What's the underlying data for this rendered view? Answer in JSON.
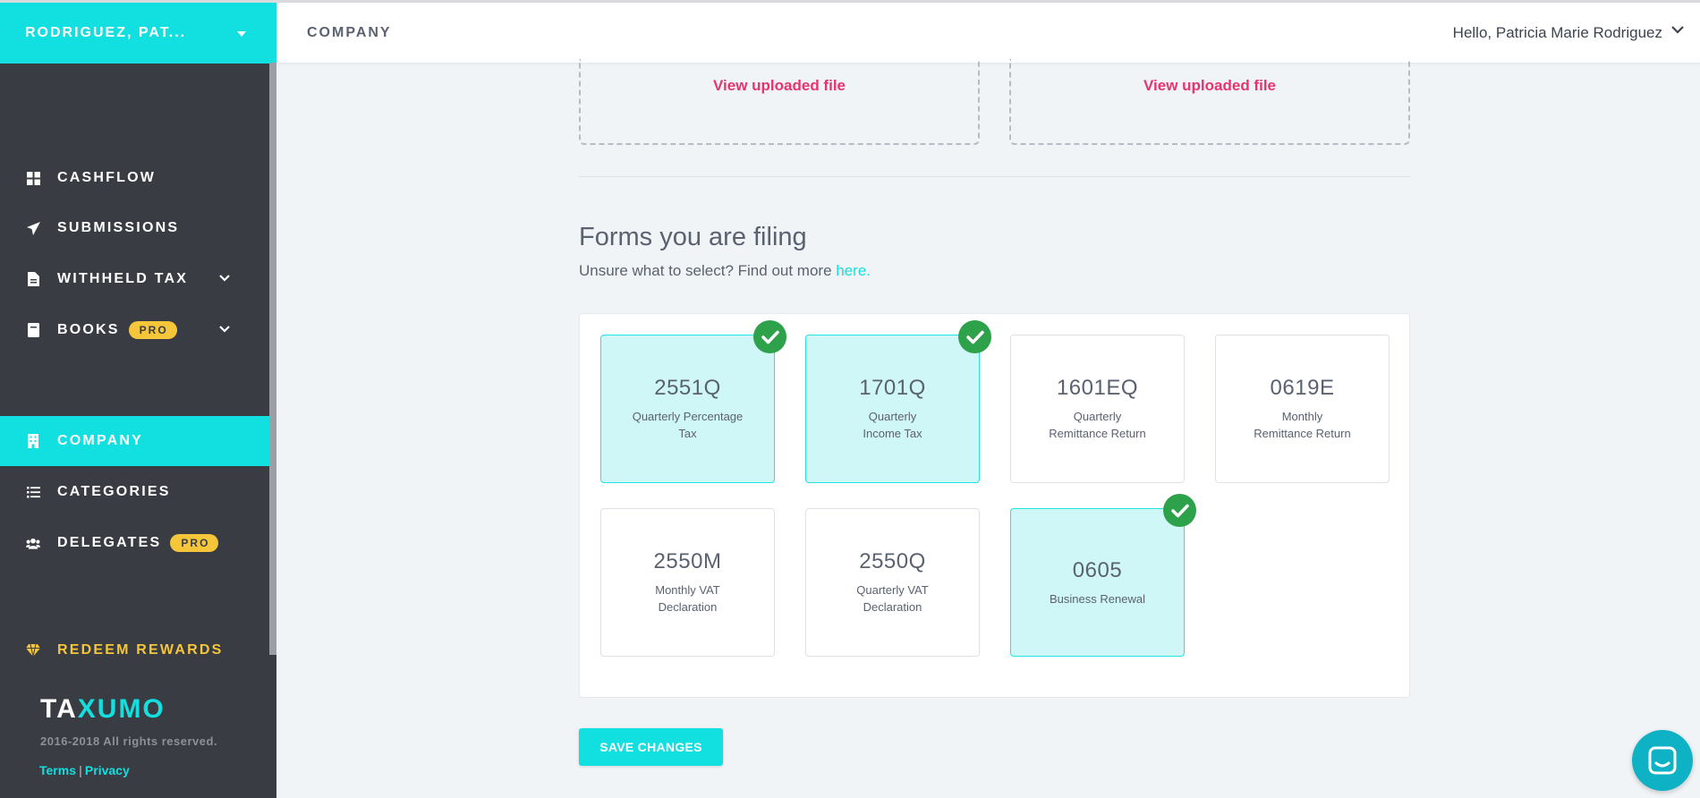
{
  "account": {
    "name": "RODRIGUEZ, PAT..."
  },
  "sidebar": {
    "items": [
      {
        "label": "CASHFLOW",
        "icon": "dashboard-icon"
      },
      {
        "label": "SUBMISSIONS",
        "icon": "paper-plane-icon"
      },
      {
        "label": "WITHHELD TAX",
        "icon": "document-icon",
        "expandable": true
      },
      {
        "label": "BOOKS",
        "icon": "book-icon",
        "badge": "PRO",
        "expandable": true
      },
      {
        "label": "COMPANY",
        "icon": "building-icon",
        "active": true
      },
      {
        "label": "CATEGORIES",
        "icon": "list-icon"
      },
      {
        "label": "DELEGATES",
        "icon": "users-icon",
        "badge": "PRO"
      }
    ],
    "redeem": "REDEEM REWARDS",
    "logo": {
      "part1": "TA",
      "part2": "XUMO"
    },
    "copyright": "2016-2018 All rights reserved.",
    "terms": "Terms",
    "separator": "|",
    "privacy": "Privacy"
  },
  "header": {
    "breadcrumb": "COMPANY",
    "greeting": "Hello, Patricia Marie Rodriguez"
  },
  "uploads": [
    {
      "link": "View uploaded file"
    },
    {
      "link": "View uploaded file"
    }
  ],
  "forms_section": {
    "title": "Forms you are filing",
    "subtitle": "Unsure what to select? Find out more ",
    "link": "here."
  },
  "forms": [
    {
      "code": "2551Q",
      "desc": "Quarterly Percentage\nTax",
      "selected": true
    },
    {
      "code": "1701Q",
      "desc": "Quarterly\nIncome Tax",
      "selected": true
    },
    {
      "code": "1601EQ",
      "desc": "Quarterly\nRemittance Return",
      "selected": false
    },
    {
      "code": "0619E",
      "desc": "Monthly\nRemittance Return",
      "selected": false
    },
    {
      "code": "2550M",
      "desc": "Monthly VAT\nDeclaration",
      "selected": false
    },
    {
      "code": "2550Q",
      "desc": "Quarterly VAT\nDeclaration",
      "selected": false
    },
    {
      "code": "0605",
      "desc": "Business Renewal",
      "selected": true
    }
  ],
  "actions": {
    "save": "SAVE CHANGES"
  },
  "colors": {
    "accent": "#12dfe0",
    "sidebar": "#393c42",
    "link_pink": "#e6346e",
    "check_green": "#2ea14b",
    "pro_badge": "#f5c53a"
  }
}
